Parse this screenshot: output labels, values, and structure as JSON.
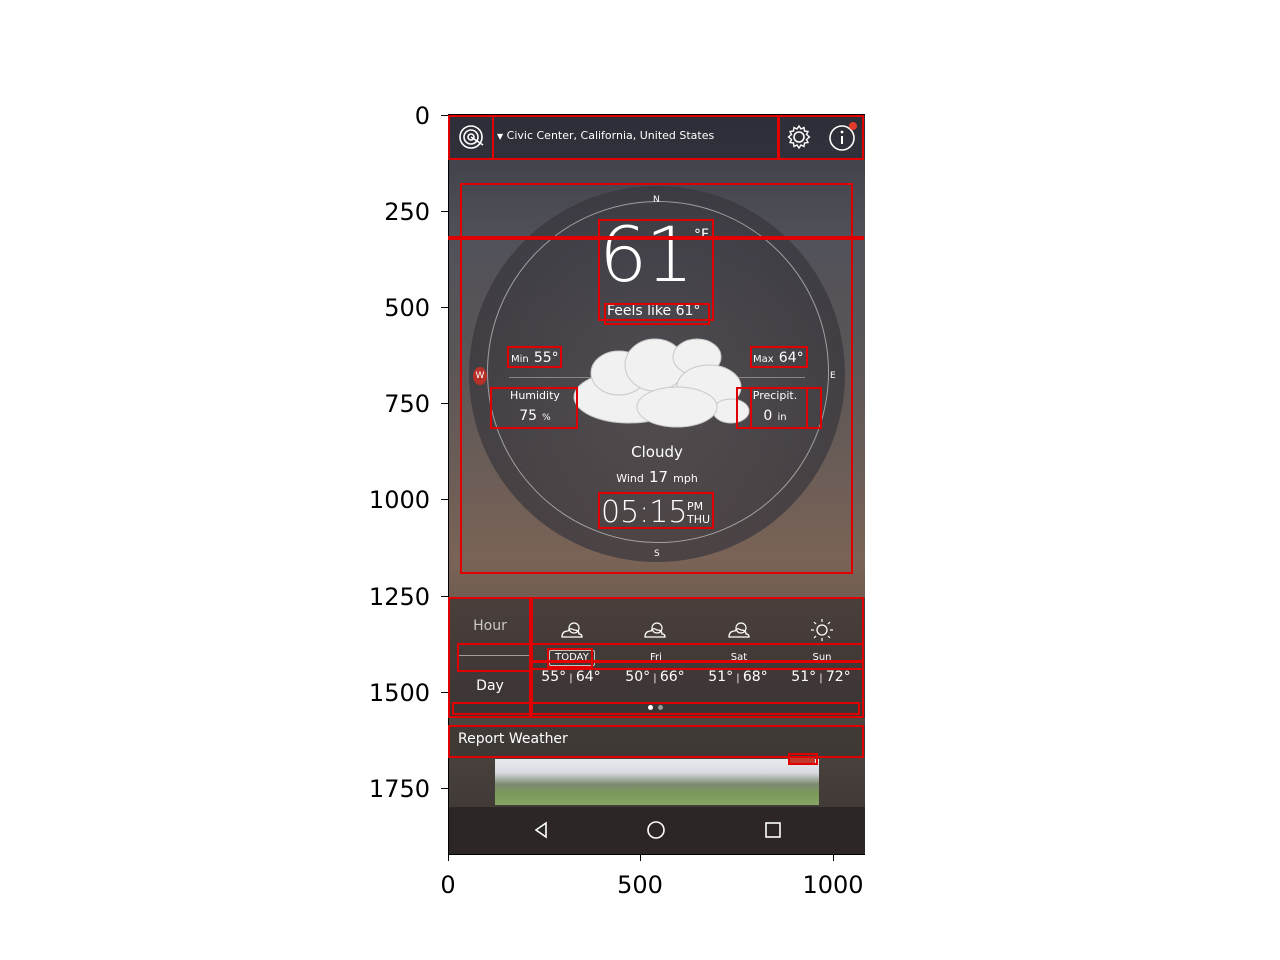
{
  "axes": {
    "y_ticks": [
      "0",
      "250",
      "500",
      "750",
      "1000",
      "1250",
      "1500",
      "1750"
    ],
    "x_ticks": [
      "0",
      "500",
      "1000"
    ]
  },
  "app": {
    "location": "Civic Center, California, United States",
    "temperature": "61",
    "unit": "°F",
    "feels_like": "Feels like 61°",
    "min_label": "Min",
    "min_value": "55°",
    "max_label": "Max",
    "max_value": "64°",
    "humidity_label": "Humidity",
    "humidity_value": "75",
    "humidity_unit": "%",
    "precip_label": "Precipit.",
    "precip_value": "0",
    "precip_unit": "in",
    "condition": "Cloudy",
    "wind_label": "Wind",
    "wind_value": "17",
    "wind_unit": "mph",
    "time": "05:15",
    "ampm": "PM",
    "weekday": "THU",
    "compass": {
      "n": "N",
      "s": "S",
      "e": "E",
      "w": "W"
    },
    "tabs": {
      "hour": "Hour",
      "day": "Day"
    },
    "days": [
      {
        "name": "TODAY",
        "low": "55°",
        "high": "64°"
      },
      {
        "name": "Fri",
        "low": "50°",
        "high": "66°"
      },
      {
        "name": "Sat",
        "low": "51°",
        "high": "68°"
      },
      {
        "name": "Sun",
        "low": "51°",
        "high": "72°"
      }
    ],
    "report": "Report Weather",
    "icons": {
      "logo": "radar-logo-icon",
      "settings": "gear-icon",
      "info": "info-icon",
      "back": "back-icon",
      "home": "home-icon",
      "recents": "recents-icon"
    }
  }
}
